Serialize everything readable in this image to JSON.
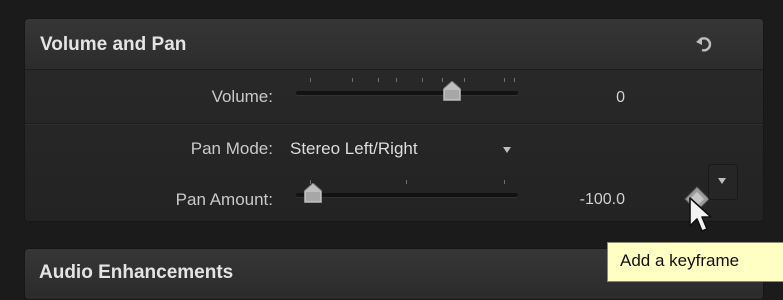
{
  "volume_and_pan": {
    "title": "Volume and Pan",
    "reset_icon": "reset-arrow-icon",
    "volume": {
      "label": "Volume:",
      "value": "0",
      "slider_fraction": 0.74
    },
    "pan_mode": {
      "label": "Pan Mode:",
      "selected": "Stereo Left/Right"
    },
    "pan_amount": {
      "label": "Pan Amount:",
      "value": "-100.0",
      "slider_fraction": 0.0,
      "keyframe_icon": "add-keyframe-diamond-icon"
    }
  },
  "audio_enhancements": {
    "title": "Audio Enhancements"
  },
  "tooltip": {
    "text": "Add a keyframe"
  },
  "colors": {
    "panel_bg": "#262626",
    "header_bg": "#333333",
    "text": "#d0d0d0",
    "tooltip_bg": "#ffffc4"
  }
}
